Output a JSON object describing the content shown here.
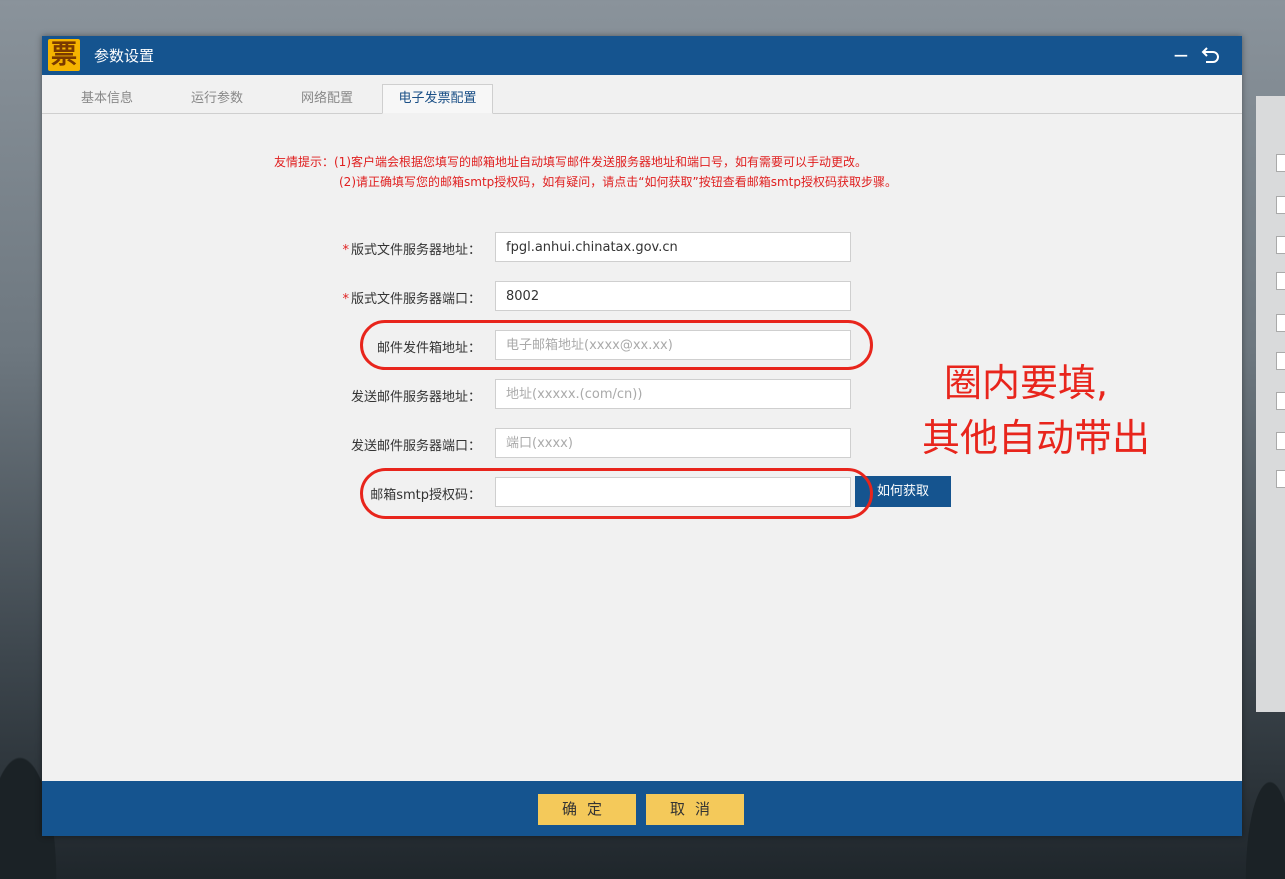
{
  "window": {
    "title": "参数设置",
    "logo_char": "票"
  },
  "tabs": [
    {
      "label": "基本信息"
    },
    {
      "label": "运行参数"
    },
    {
      "label": "网络配置"
    },
    {
      "label": "电子发票配置",
      "active": true
    }
  ],
  "notice": {
    "line1": "友情提示：(1)客户端会根据您填写的邮箱地址自动填写邮件发送服务器地址和端口号，如有需要可以手动更改。",
    "line2": "(2)请正确填写您的邮箱smtp授权码，如有疑问，请点击“如何获取”按钮查看邮箱smtp授权码获取步骤。"
  },
  "form": {
    "server_address": {
      "label": "版式文件服务器地址：",
      "required": true,
      "value": "fpgl.anhui.chinatax.gov.cn",
      "placeholder": ""
    },
    "server_port": {
      "label": "版式文件服务器端口：",
      "required": true,
      "value": "8002",
      "placeholder": ""
    },
    "sender_email": {
      "label": "邮件发件箱地址：",
      "value": "",
      "placeholder": "电子邮箱地址(xxxx@xx.xx)"
    },
    "smtp_address": {
      "label": "发送邮件服务器地址：",
      "value": "",
      "placeholder": "地址(xxxxx.(com/cn))"
    },
    "smtp_port": {
      "label": "发送邮件服务器端口：",
      "value": "",
      "placeholder": "端口(xxxx)"
    },
    "smtp_auth": {
      "label": "邮箱smtp授权码：",
      "value": "",
      "placeholder": ""
    },
    "how_to_get_label": "如何获取"
  },
  "annotation": {
    "line1": "圈内要填,",
    "line2": "其他自动带出",
    "color": "#e8251c"
  },
  "footer": {
    "confirm_label": "确定",
    "cancel_label": "取消"
  },
  "colors": {
    "titlebar": "#15548f",
    "button_yellow": "#f4c95a",
    "notice_red": "#e02020"
  }
}
